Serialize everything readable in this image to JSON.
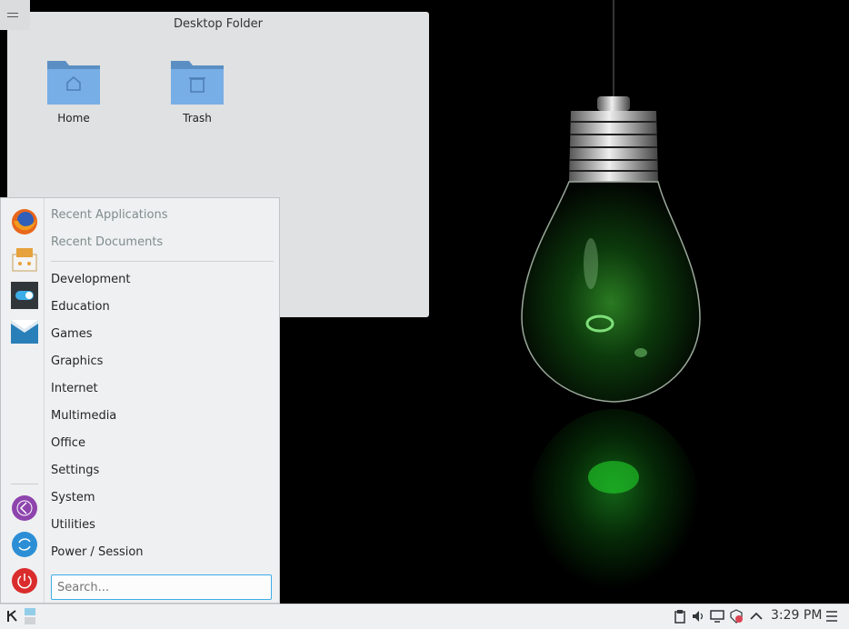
{
  "desktop_folder": {
    "title": "Desktop Folder",
    "items": [
      {
        "label": "Home",
        "icon": "folder-home-icon"
      },
      {
        "label": "Trash",
        "icon": "trash-folder-icon"
      }
    ]
  },
  "launcher": {
    "favorites": [
      {
        "name": "Firefox",
        "icon": "firefox-icon"
      },
      {
        "name": "Software installer",
        "icon": "package-installer-icon"
      },
      {
        "name": "System settings",
        "icon": "toggle-settings-icon"
      },
      {
        "name": "Mail",
        "icon": "mail-icon"
      }
    ],
    "session_buttons": [
      {
        "icon": "logout-icon"
      },
      {
        "icon": "restart-icon"
      },
      {
        "icon": "power-icon"
      }
    ],
    "recent": [
      "Recent Applications",
      "Recent Documents"
    ],
    "categories": [
      "Development",
      "Education",
      "Games",
      "Graphics",
      "Internet",
      "Multimedia",
      "Office",
      "Settings",
      "System",
      "Utilities",
      "Power / Session"
    ],
    "search_placeholder": "Search..."
  },
  "panel": {
    "clock": "3:29 PM",
    "tray_icons": [
      "clipboard-icon",
      "volume-icon",
      "display-icon",
      "updates-icon",
      "expand-tray-icon",
      "panel-menu-icon"
    ]
  },
  "colors": {
    "accent": "#3daee9",
    "panel_bg": "#eff0f1",
    "bulb_glow": "#2fd63a"
  }
}
